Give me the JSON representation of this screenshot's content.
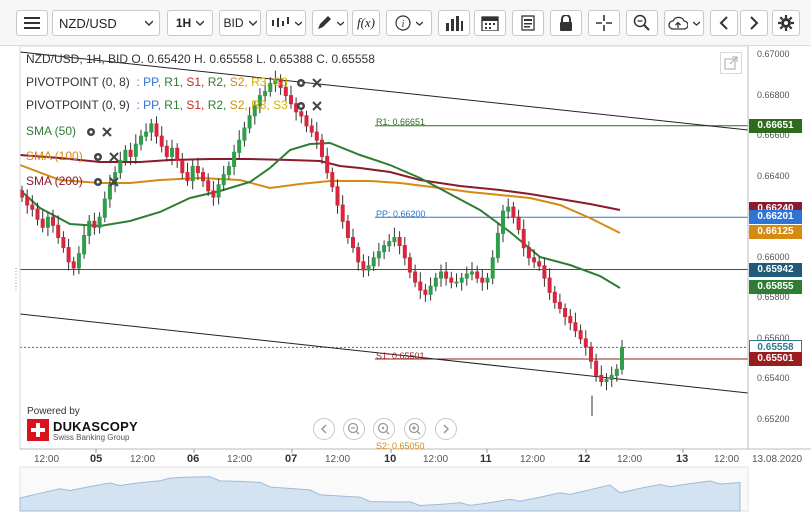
{
  "toolbar": {
    "symbol": "NZD/USD",
    "timeframe": "1H",
    "price_side": "BID",
    "fx_label": "f(x)"
  },
  "ohlc_text": "NZD/USD, 1H, BID   O. 0.65420 H. 0.65558 L. 0.65388 C. 0.65558",
  "indicators": [
    {
      "name": "PIVOTPOINT (0, 8)",
      "legend": ": PP, R1, S1, R2, S2, R3, S3"
    },
    {
      "name": "PIVOTPOINT (0, 9)",
      "legend": ": PP, R1, S1, R2, S2, R3, S3"
    },
    {
      "name": "SMA (50)",
      "color": "#2e7d32"
    },
    {
      "name": "SMA (100)",
      "color": "#d58a12"
    },
    {
      "name": "SMA (200)",
      "color": "#8b1a2e"
    }
  ],
  "pivot_labels": {
    "r1": "R1: 0.66651",
    "pp": "PP: 0.66200",
    "s1": "S1: 0.65501",
    "s2": "S2: 0.65050"
  },
  "price_axis": [
    "0.67000",
    "0.66800",
    "0.66600",
    "0.66400",
    "0.66200",
    "0.66000",
    "0.65800",
    "0.65600",
    "0.65400",
    "0.65200"
  ],
  "price_tags": [
    {
      "value": "0.66651",
      "color": "#2e6b1f"
    },
    {
      "value": "0.66240",
      "color": "#8b1a2e"
    },
    {
      "value": "0.66201",
      "color": "#2e74d6"
    },
    {
      "value": "0.66125",
      "color": "#d58a12"
    },
    {
      "value": "0.65942",
      "color": "#1f5a78"
    },
    {
      "value": "0.65855",
      "color": "#2e7d32"
    },
    {
      "value": "0.65558",
      "color": "#ffffff"
    },
    {
      "value": "0.65501",
      "color": "#9b1c1c"
    }
  ],
  "time_axis": [
    {
      "label": "12:00",
      "day": false
    },
    {
      "label": "05",
      "day": true
    },
    {
      "label": "12:00",
      "day": false
    },
    {
      "label": "06",
      "day": true
    },
    {
      "label": "12:00",
      "day": false
    },
    {
      "label": "07",
      "day": true
    },
    {
      "label": "12:00",
      "day": false
    },
    {
      "label": "10",
      "day": true
    },
    {
      "label": "12:00",
      "day": false
    },
    {
      "label": "11",
      "day": true
    },
    {
      "label": "12:00",
      "day": false
    },
    {
      "label": "12",
      "day": true
    },
    {
      "label": "12:00",
      "day": false
    },
    {
      "label": "13",
      "day": true
    },
    {
      "label": "12:00",
      "day": false
    },
    {
      "label": "13.08.2020",
      "day": false
    }
  ],
  "branding": {
    "powered_by": "Powered by",
    "name": "DUKASCOPY",
    "tagline": "Swiss Banking Group"
  }
}
